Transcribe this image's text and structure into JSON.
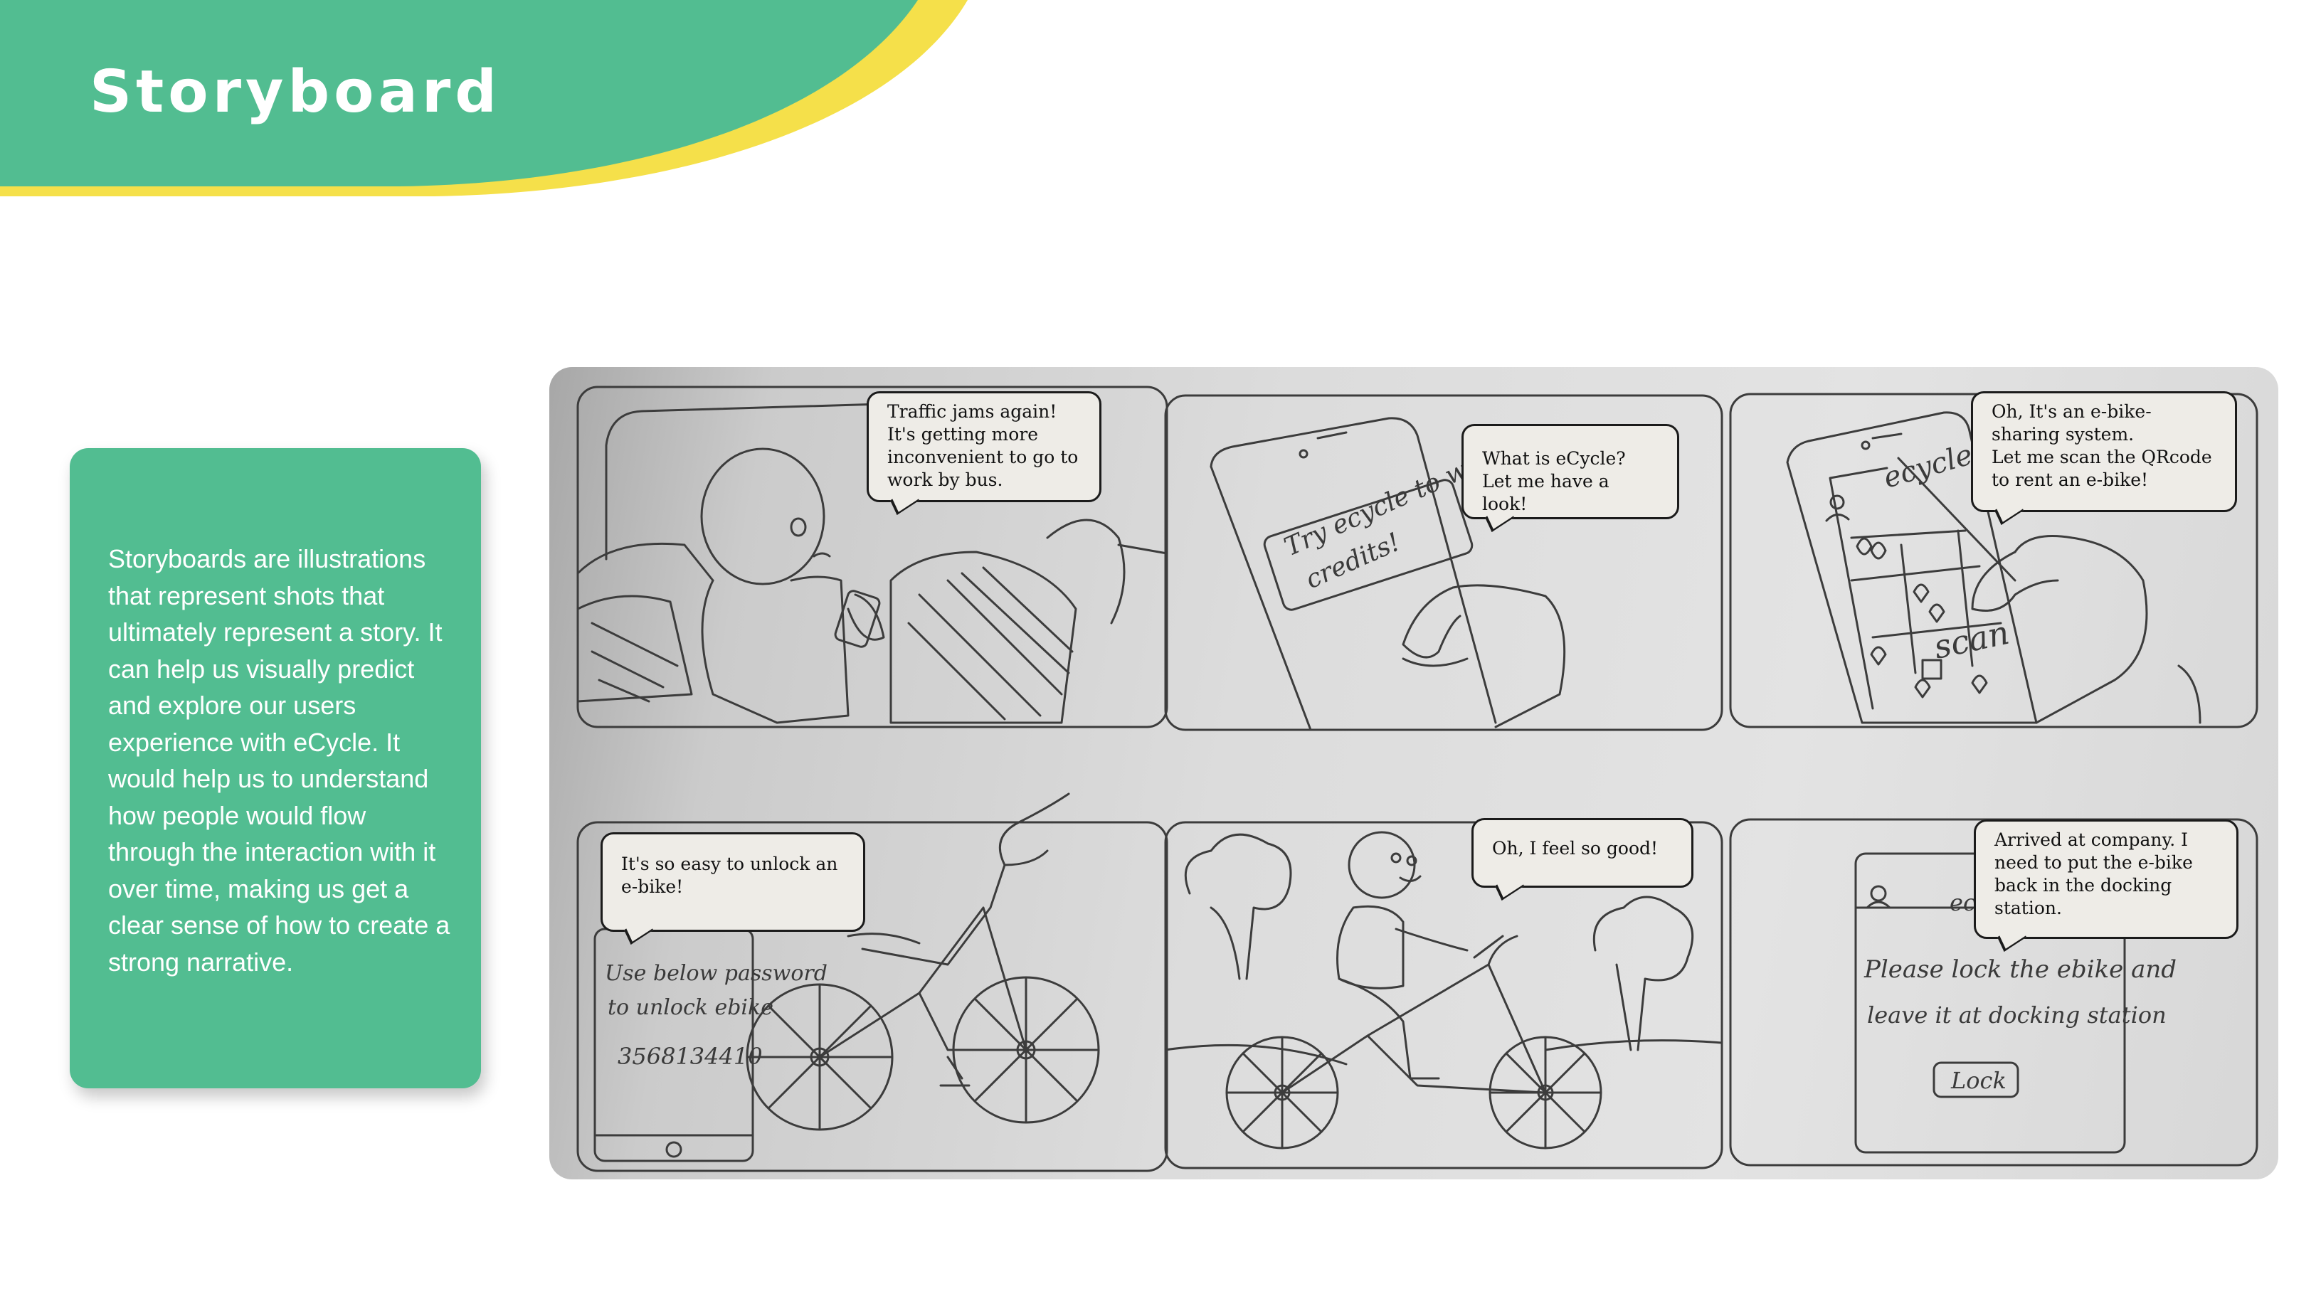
{
  "page": {
    "title": "Storyboard"
  },
  "colors": {
    "primary_green": "#52bd91",
    "accent_yellow": "#f5e04a",
    "bubble_fill": "#eeece7"
  },
  "description": "Storyboards are illustrations that represent shots that ultimately represent a story. It can help us visually predict and explore our users experience with eCycle. It would help us to understand how people would flow through the interaction with it over time, making us get a clear sense of how to create a strong narrative.",
  "storyboard": {
    "panels": [
      {
        "bubble": "Traffic jams again!\nIt's getting more\ninconvenient to go to\nwork by bus."
      },
      {
        "bubble": "What is eCycle?\nLet me have a  look!",
        "sketch_text": "Try ecycle to win credits!"
      },
      {
        "bubble": "Oh, It's an e-bike-\nsharing system.\nLet me scan the QRcode\nto rent an e-bike!",
        "sketch_text": [
          "ecycle",
          "scan"
        ]
      },
      {
        "bubble": "It's so easy to unlock an\ne-bike!",
        "sketch_text": [
          "Use below password",
          "to unlock ebike",
          "3568134410"
        ]
      },
      {
        "bubble": "Oh, I feel so good!"
      },
      {
        "bubble": "Arrived at company. I\nneed to put the e-bike\nback in the docking\nstation.",
        "sketch_text": [
          "ec",
          "Please lock the ebike and",
          "leave it at docking station",
          "Lock"
        ]
      }
    ]
  }
}
